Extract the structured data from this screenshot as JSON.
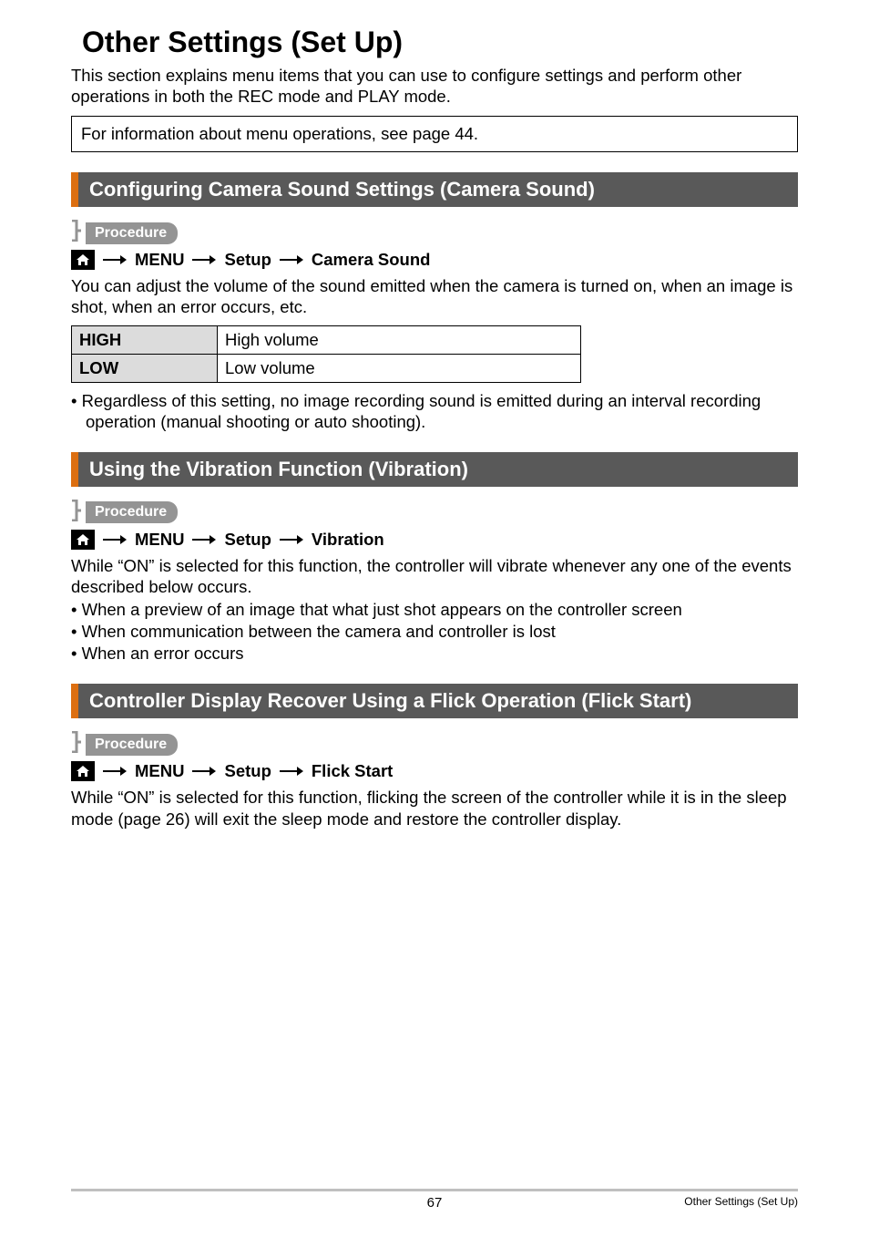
{
  "title": "Other Settings (Set Up)",
  "intro": "This section explains menu items that you can use to configure settings and perform other operations in both the REC mode and PLAY mode.",
  "note": "For information about menu operations, see page 44.",
  "proc_label": "Procedure",
  "path": {
    "menu": "MENU",
    "setup": "Setup"
  },
  "sec1": {
    "heading": "Configuring Camera Sound Settings (Camera Sound)",
    "target": "Camera Sound",
    "desc": "You can adjust the volume of the sound emitted when the camera is turned on, when an image is shot, when an error occurs, etc.",
    "table": [
      {
        "k": "HIGH",
        "v": "High volume"
      },
      {
        "k": "LOW",
        "v": "Low volume"
      }
    ],
    "bullets": [
      "Regardless of this setting, no image recording sound is emitted during an interval recording operation (manual shooting or auto shooting)."
    ]
  },
  "sec2": {
    "heading": "Using the Vibration Function (Vibration)",
    "target": "Vibration",
    "desc": "While “ON” is selected for this function, the controller will vibrate whenever any one of the events described below occurs.",
    "bullets": [
      "When a preview of an image that what just shot appears on the controller screen",
      "When communication between the camera and controller is lost",
      "When an error occurs"
    ]
  },
  "sec3": {
    "heading": "Controller Display Recover Using a Flick Operation (Flick Start)",
    "target": "Flick Start",
    "desc": "While “ON” is selected for this function, flicking the screen of the controller while it is in the sleep mode (page 26) will exit the sleep mode and restore the controller display."
  },
  "footer": {
    "page": "67",
    "section": "Other Settings (Set Up)"
  }
}
